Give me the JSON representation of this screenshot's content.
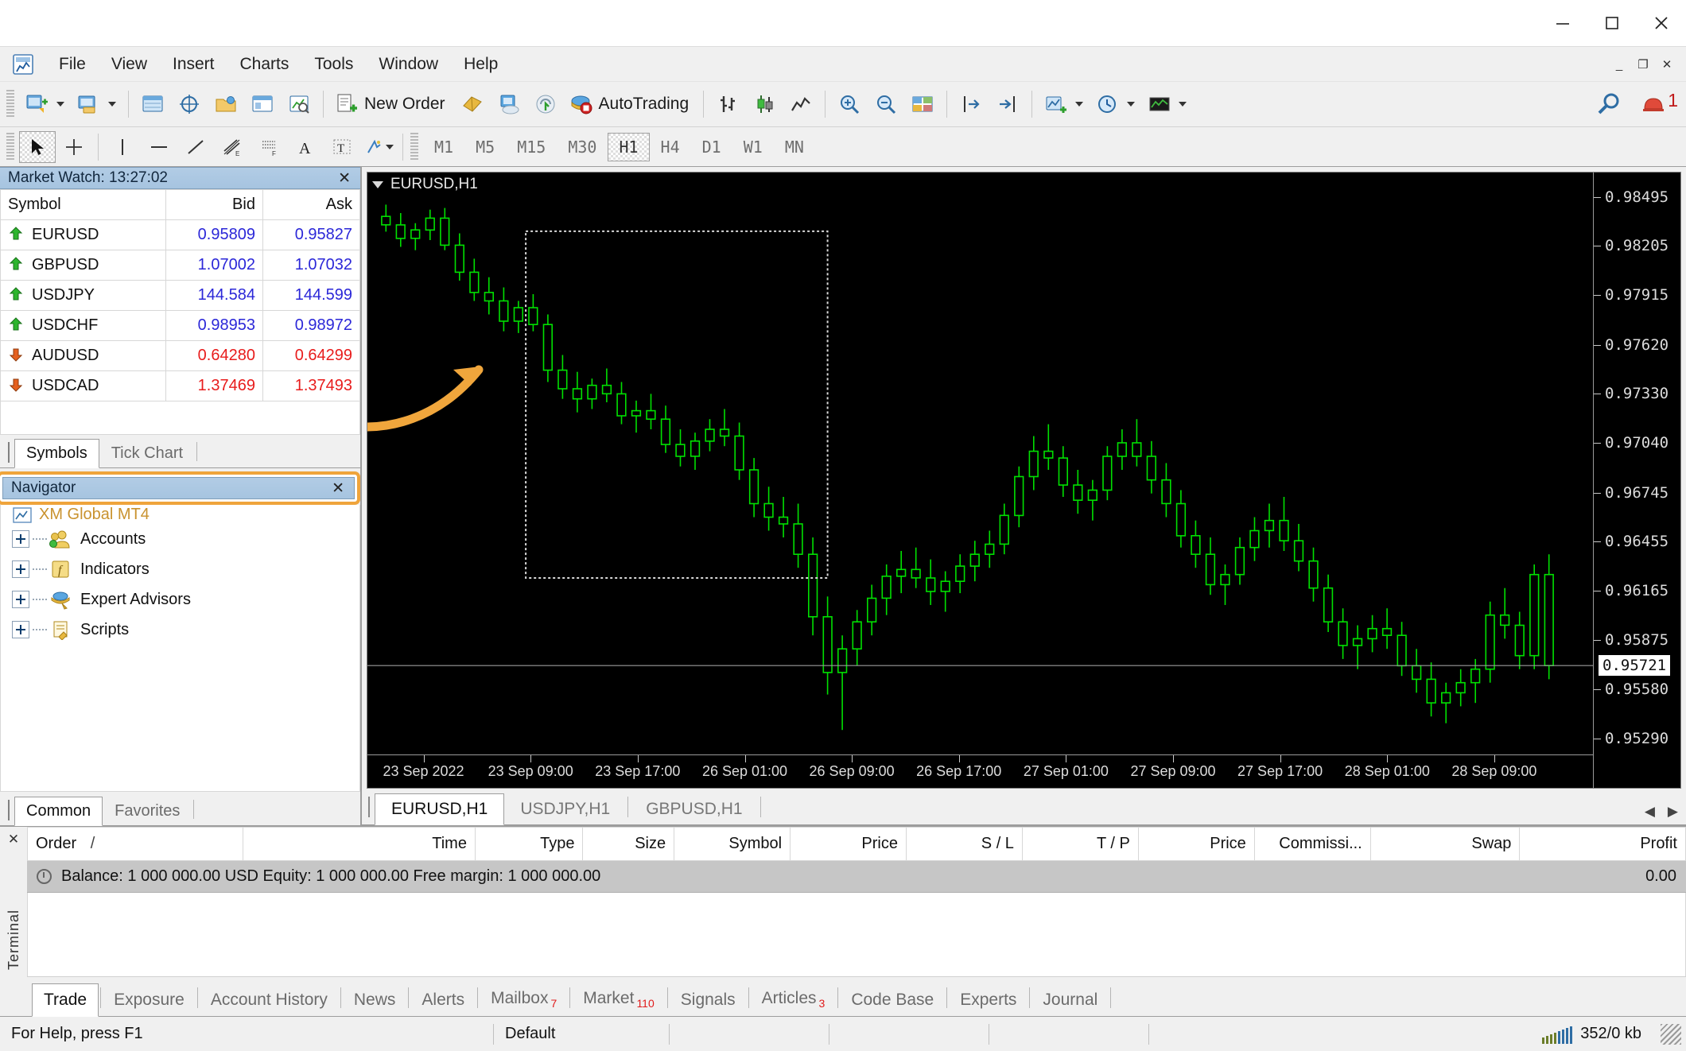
{
  "window": {
    "minimize": "–",
    "maximize": "□",
    "close": "✕",
    "mdi_minimize": "_",
    "mdi_restore": "❐",
    "mdi_close": "✕"
  },
  "menu": {
    "items": [
      "File",
      "View",
      "Insert",
      "Charts",
      "Tools",
      "Window",
      "Help"
    ]
  },
  "toolbar": {
    "new_order_label": "New Order",
    "autotrading_label": "AutoTrading",
    "notification_count": "1"
  },
  "timeframes": {
    "items": [
      "M1",
      "M5",
      "M15",
      "M30",
      "H1",
      "H4",
      "D1",
      "W1",
      "MN"
    ],
    "active": "H1"
  },
  "market_watch": {
    "title": "Market Watch: 13:27:02",
    "close_label": "✕",
    "columns": [
      "Symbol",
      "Bid",
      "Ask"
    ],
    "rows": [
      {
        "symbol": "EURUSD",
        "bid": "0.95809",
        "ask": "0.95827",
        "dir": "up"
      },
      {
        "symbol": "GBPUSD",
        "bid": "1.07002",
        "ask": "1.07032",
        "dir": "up"
      },
      {
        "symbol": "USDJPY",
        "bid": "144.584",
        "ask": "144.599",
        "dir": "up"
      },
      {
        "symbol": "USDCHF",
        "bid": "0.98953",
        "ask": "0.98972",
        "dir": "up"
      },
      {
        "symbol": "AUDUSD",
        "bid": "0.64280",
        "ask": "0.64299",
        "dir": "down"
      },
      {
        "symbol": "USDCAD",
        "bid": "1.37469",
        "ask": "1.37493",
        "dir": "down"
      }
    ],
    "tabs": [
      {
        "label": "Symbols",
        "active": true
      },
      {
        "label": "Tick Chart",
        "active": false
      }
    ]
  },
  "navigator": {
    "title": "Navigator",
    "close_label": "✕",
    "highlight_color": "#efa43b",
    "tree": [
      {
        "label": "XM Global MT4",
        "icon": "terminal-icon",
        "expandable": false,
        "clipped": true
      },
      {
        "label": "Accounts",
        "icon": "accounts-icon",
        "expandable": true
      },
      {
        "label": "Indicators",
        "icon": "indicators-icon",
        "expandable": true
      },
      {
        "label": "Expert Advisors",
        "icon": "expert-advisors-icon",
        "expandable": true
      },
      {
        "label": "Scripts",
        "icon": "scripts-icon",
        "expandable": true
      }
    ],
    "tabs": [
      {
        "label": "Common",
        "active": true
      },
      {
        "label": "Favorites",
        "active": false
      }
    ]
  },
  "chart": {
    "header": "EURUSD,H1",
    "tabs": [
      {
        "label": "EURUSD,H1",
        "active": true
      },
      {
        "label": "USDJPY,H1",
        "active": false
      },
      {
        "label": "GBPUSD,H1",
        "active": false
      }
    ],
    "current_price": "0.95721",
    "background": "#000000",
    "bull_color": "#00e000",
    "selection_box": true
  },
  "chart_data": {
    "type": "candlestick",
    "title": "EURUSD,H1",
    "symbol": "EURUSD",
    "timeframe": "H1",
    "xlabel": "",
    "ylabel": "",
    "grid": false,
    "legend": "none",
    "ylim": [
      0.95195,
      0.9864
    ],
    "price_ticks": [
      "0.98495",
      "0.98205",
      "0.97915",
      "0.97620",
      "0.97330",
      "0.97040",
      "0.96745",
      "0.96455",
      "0.96165",
      "0.95875",
      "0.95580",
      "0.95290"
    ],
    "price_tick_values": [
      0.98495,
      0.98205,
      0.97915,
      0.9762,
      0.9733,
      0.9704,
      0.96745,
      0.96455,
      0.96165,
      0.95875,
      0.9558,
      0.9529
    ],
    "current_price_line": 0.95721,
    "time_ticks": [
      "23 Sep 2022",
      "23 Sep 09:00",
      "23 Sep 17:00",
      "26 Sep 01:00",
      "26 Sep 09:00",
      "26 Sep 17:00",
      "27 Sep 01:00",
      "27 Sep 09:00",
      "27 Sep 17:00",
      "28 Sep 01:00",
      "28 Sep 09:00"
    ],
    "candles": [
      {
        "o": 0.9838,
        "h": 0.9845,
        "l": 0.9829,
        "c": 0.9833
      },
      {
        "o": 0.9833,
        "h": 0.984,
        "l": 0.982,
        "c": 0.9825
      },
      {
        "o": 0.9825,
        "h": 0.9834,
        "l": 0.9818,
        "c": 0.983
      },
      {
        "o": 0.983,
        "h": 0.9842,
        "l": 0.9824,
        "c": 0.9837
      },
      {
        "o": 0.9837,
        "h": 0.9843,
        "l": 0.9818,
        "c": 0.9821
      },
      {
        "o": 0.9821,
        "h": 0.9828,
        "l": 0.98,
        "c": 0.9805
      },
      {
        "o": 0.9805,
        "h": 0.9813,
        "l": 0.9788,
        "c": 0.9793
      },
      {
        "o": 0.9793,
        "h": 0.9802,
        "l": 0.978,
        "c": 0.9788
      },
      {
        "o": 0.9788,
        "h": 0.9796,
        "l": 0.977,
        "c": 0.9776
      },
      {
        "o": 0.9776,
        "h": 0.9788,
        "l": 0.9769,
        "c": 0.9784
      },
      {
        "o": 0.9784,
        "h": 0.9792,
        "l": 0.977,
        "c": 0.9774
      },
      {
        "o": 0.9774,
        "h": 0.978,
        "l": 0.974,
        "c": 0.9747
      },
      {
        "o": 0.9747,
        "h": 0.9756,
        "l": 0.973,
        "c": 0.9736
      },
      {
        "o": 0.9736,
        "h": 0.9746,
        "l": 0.9722,
        "c": 0.973
      },
      {
        "o": 0.973,
        "h": 0.9742,
        "l": 0.9724,
        "c": 0.9738
      },
      {
        "o": 0.9738,
        "h": 0.9748,
        "l": 0.9728,
        "c": 0.9733
      },
      {
        "o": 0.9733,
        "h": 0.974,
        "l": 0.9715,
        "c": 0.972
      },
      {
        "o": 0.972,
        "h": 0.9729,
        "l": 0.971,
        "c": 0.9723
      },
      {
        "o": 0.9723,
        "h": 0.9733,
        "l": 0.9712,
        "c": 0.9718
      },
      {
        "o": 0.9718,
        "h": 0.9726,
        "l": 0.9698,
        "c": 0.9703
      },
      {
        "o": 0.9703,
        "h": 0.9712,
        "l": 0.969,
        "c": 0.9696
      },
      {
        "o": 0.9696,
        "h": 0.971,
        "l": 0.9688,
        "c": 0.9705
      },
      {
        "o": 0.9705,
        "h": 0.9718,
        "l": 0.9699,
        "c": 0.9712
      },
      {
        "o": 0.9712,
        "h": 0.9724,
        "l": 0.9702,
        "c": 0.9708
      },
      {
        "o": 0.9708,
        "h": 0.9716,
        "l": 0.9682,
        "c": 0.9688
      },
      {
        "o": 0.9688,
        "h": 0.9695,
        "l": 0.966,
        "c": 0.9668
      },
      {
        "o": 0.9668,
        "h": 0.9678,
        "l": 0.9652,
        "c": 0.966
      },
      {
        "o": 0.966,
        "h": 0.9672,
        "l": 0.9648,
        "c": 0.9656
      },
      {
        "o": 0.9656,
        "h": 0.9668,
        "l": 0.963,
        "c": 0.9638
      },
      {
        "o": 0.9638,
        "h": 0.9648,
        "l": 0.959,
        "c": 0.9601
      },
      {
        "o": 0.9601,
        "h": 0.9613,
        "l": 0.9555,
        "c": 0.9568
      },
      {
        "o": 0.9568,
        "h": 0.959,
        "l": 0.9534,
        "c": 0.9582
      },
      {
        "o": 0.9582,
        "h": 0.9605,
        "l": 0.9572,
        "c": 0.9598
      },
      {
        "o": 0.9598,
        "h": 0.962,
        "l": 0.959,
        "c": 0.9612
      },
      {
        "o": 0.9612,
        "h": 0.9632,
        "l": 0.9602,
        "c": 0.9625
      },
      {
        "o": 0.9625,
        "h": 0.964,
        "l": 0.9615,
        "c": 0.9629
      },
      {
        "o": 0.9629,
        "h": 0.9642,
        "l": 0.9618,
        "c": 0.9624
      },
      {
        "o": 0.9624,
        "h": 0.9635,
        "l": 0.9608,
        "c": 0.9616
      },
      {
        "o": 0.9616,
        "h": 0.9628,
        "l": 0.9604,
        "c": 0.9622
      },
      {
        "o": 0.9622,
        "h": 0.9638,
        "l": 0.9615,
        "c": 0.9631
      },
      {
        "o": 0.9631,
        "h": 0.9646,
        "l": 0.9622,
        "c": 0.9638
      },
      {
        "o": 0.9638,
        "h": 0.9652,
        "l": 0.963,
        "c": 0.9644
      },
      {
        "o": 0.9644,
        "h": 0.9668,
        "l": 0.9638,
        "c": 0.9661
      },
      {
        "o": 0.9661,
        "h": 0.969,
        "l": 0.9654,
        "c": 0.9684
      },
      {
        "o": 0.9684,
        "h": 0.9708,
        "l": 0.9676,
        "c": 0.9699
      },
      {
        "o": 0.9699,
        "h": 0.9715,
        "l": 0.9688,
        "c": 0.9695
      },
      {
        "o": 0.9695,
        "h": 0.9702,
        "l": 0.9672,
        "c": 0.9679
      },
      {
        "o": 0.9679,
        "h": 0.9688,
        "l": 0.9662,
        "c": 0.967
      },
      {
        "o": 0.967,
        "h": 0.9682,
        "l": 0.9658,
        "c": 0.9676
      },
      {
        "o": 0.9676,
        "h": 0.9702,
        "l": 0.967,
        "c": 0.9696
      },
      {
        "o": 0.9696,
        "h": 0.9712,
        "l": 0.9688,
        "c": 0.9704
      },
      {
        "o": 0.9704,
        "h": 0.9718,
        "l": 0.969,
        "c": 0.9696
      },
      {
        "o": 0.9696,
        "h": 0.9705,
        "l": 0.9674,
        "c": 0.9682
      },
      {
        "o": 0.9682,
        "h": 0.9692,
        "l": 0.966,
        "c": 0.9668
      },
      {
        "o": 0.9668,
        "h": 0.9676,
        "l": 0.9642,
        "c": 0.9649
      },
      {
        "o": 0.9649,
        "h": 0.9658,
        "l": 0.963,
        "c": 0.9638
      },
      {
        "o": 0.9638,
        "h": 0.9648,
        "l": 0.9614,
        "c": 0.962
      },
      {
        "o": 0.962,
        "h": 0.9632,
        "l": 0.9608,
        "c": 0.9626
      },
      {
        "o": 0.9626,
        "h": 0.9648,
        "l": 0.962,
        "c": 0.9642
      },
      {
        "o": 0.9642,
        "h": 0.966,
        "l": 0.9634,
        "c": 0.9652
      },
      {
        "o": 0.9652,
        "h": 0.9668,
        "l": 0.9642,
        "c": 0.9658
      },
      {
        "o": 0.9658,
        "h": 0.9672,
        "l": 0.964,
        "c": 0.9646
      },
      {
        "o": 0.9646,
        "h": 0.9656,
        "l": 0.9628,
        "c": 0.9634
      },
      {
        "o": 0.9634,
        "h": 0.9642,
        "l": 0.961,
        "c": 0.9618
      },
      {
        "o": 0.9618,
        "h": 0.9626,
        "l": 0.9592,
        "c": 0.9598
      },
      {
        "o": 0.9598,
        "h": 0.9606,
        "l": 0.9576,
        "c": 0.9584
      },
      {
        "o": 0.9584,
        "h": 0.9596,
        "l": 0.957,
        "c": 0.9588
      },
      {
        "o": 0.9588,
        "h": 0.9602,
        "l": 0.958,
        "c": 0.9594
      },
      {
        "o": 0.9594,
        "h": 0.9606,
        "l": 0.9582,
        "c": 0.959
      },
      {
        "o": 0.959,
        "h": 0.9598,
        "l": 0.9566,
        "c": 0.9572
      },
      {
        "o": 0.9572,
        "h": 0.9582,
        "l": 0.9556,
        "c": 0.9564
      },
      {
        "o": 0.9564,
        "h": 0.9574,
        "l": 0.9542,
        "c": 0.955
      },
      {
        "o": 0.955,
        "h": 0.9562,
        "l": 0.9538,
        "c": 0.9556
      },
      {
        "o": 0.9556,
        "h": 0.957,
        "l": 0.9548,
        "c": 0.9562
      },
      {
        "o": 0.9562,
        "h": 0.9576,
        "l": 0.955,
        "c": 0.957
      },
      {
        "o": 0.957,
        "h": 0.961,
        "l": 0.9562,
        "c": 0.9602
      },
      {
        "o": 0.9602,
        "h": 0.9618,
        "l": 0.9588,
        "c": 0.9596
      },
      {
        "o": 0.9596,
        "h": 0.9604,
        "l": 0.957,
        "c": 0.9578
      },
      {
        "o": 0.9578,
        "h": 0.9632,
        "l": 0.957,
        "c": 0.9626
      },
      {
        "o": 0.9626,
        "h": 0.9638,
        "l": 0.9564,
        "c": 0.95721
      }
    ]
  },
  "terminal": {
    "close_label": "✕",
    "side_label": "Terminal",
    "columns": [
      "Order",
      "Time",
      "Type",
      "Size",
      "Symbol",
      "Price",
      "S / L",
      "T / P",
      "Price",
      "Commissi...",
      "Swap",
      "Profit"
    ],
    "order_sort_mark": "/",
    "balance_line": "Balance: 1 000 000.00 USD  Equity: 1 000 000.00  Free margin: 1 000 000.00",
    "profit_value": "0.00",
    "tabs": [
      {
        "label": "Trade",
        "active": true,
        "badge": ""
      },
      {
        "label": "Exposure",
        "active": false,
        "badge": ""
      },
      {
        "label": "Account History",
        "active": false,
        "badge": ""
      },
      {
        "label": "News",
        "active": false,
        "badge": ""
      },
      {
        "label": "Alerts",
        "active": false,
        "badge": ""
      },
      {
        "label": "Mailbox",
        "active": false,
        "badge": "7"
      },
      {
        "label": "Market",
        "active": false,
        "badge": "110"
      },
      {
        "label": "Signals",
        "active": false,
        "badge": ""
      },
      {
        "label": "Articles",
        "active": false,
        "badge": "3"
      },
      {
        "label": "Code Base",
        "active": false,
        "badge": ""
      },
      {
        "label": "Experts",
        "active": false,
        "badge": ""
      },
      {
        "label": "Journal",
        "active": false,
        "badge": ""
      }
    ]
  },
  "statusbar": {
    "help_text": "For Help, press F1",
    "profile": "Default",
    "traffic": "352/0 kb"
  }
}
